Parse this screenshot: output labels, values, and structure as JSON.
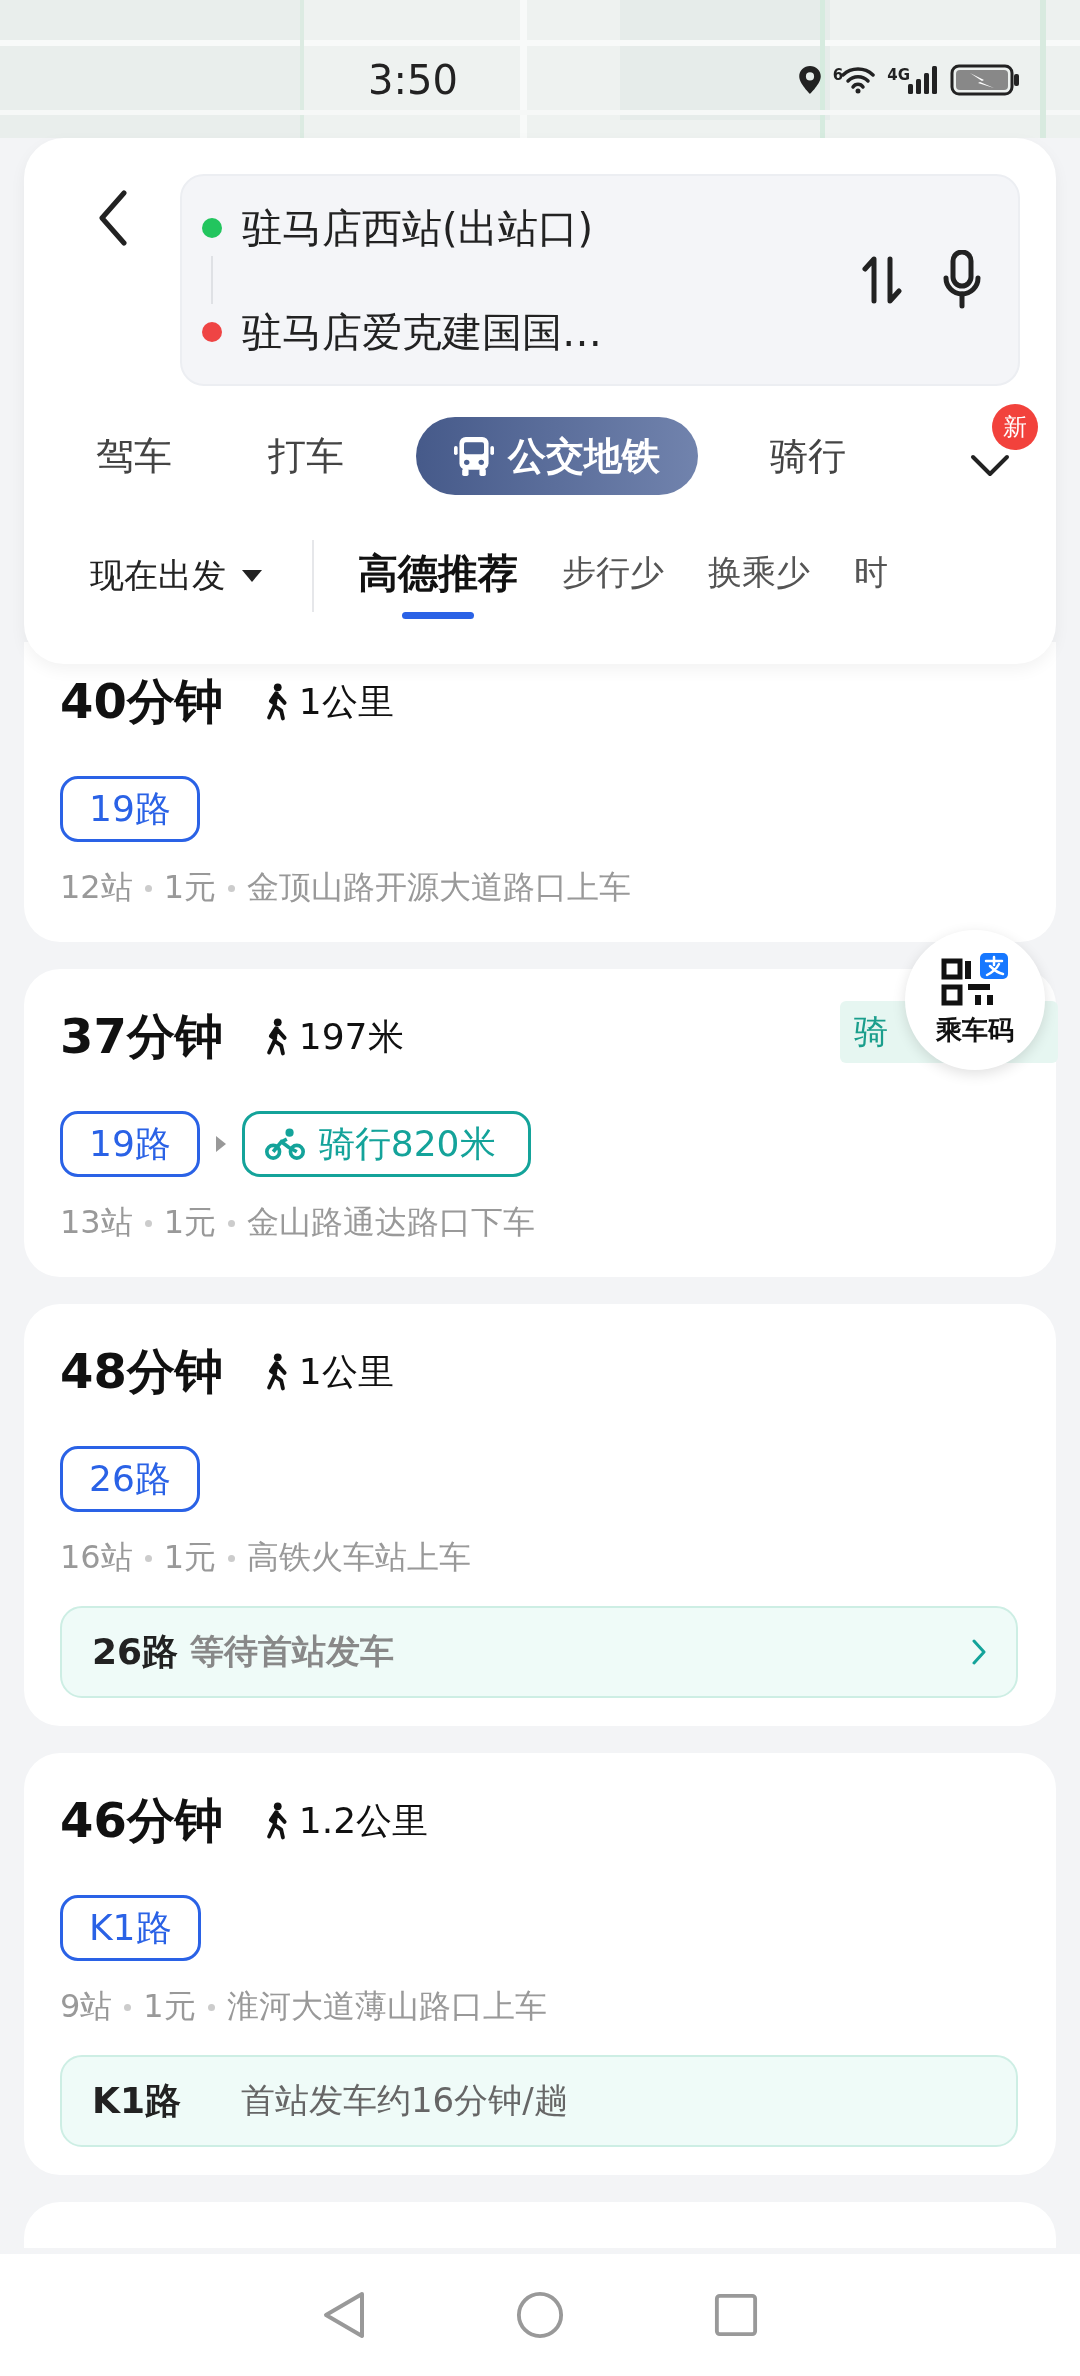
{
  "status_bar": {
    "time": "3:50",
    "wifi_label": "6",
    "cell_label": "4G"
  },
  "search": {
    "origin": {
      "text": "驻马店西站(出站口)",
      "color": "#22c55e"
    },
    "destination": {
      "text": "驻马店爱克建国国…",
      "color": "#ef4444"
    }
  },
  "mode_tabs": [
    {
      "label": "驾车",
      "selected": false
    },
    {
      "label": "打车",
      "selected": false
    },
    {
      "label": "公交地铁",
      "selected": true
    },
    {
      "label": "骑行",
      "selected": false
    }
  ],
  "more_badge": "新",
  "departure": "现在出发",
  "sort_tabs": [
    {
      "label": "高德推荐",
      "selected": true
    },
    {
      "label": "步行少",
      "selected": false
    },
    {
      "label": "换乘少",
      "selected": false
    },
    {
      "label": "时",
      "selected": false
    }
  ],
  "routes": [
    {
      "duration": "40分钟",
      "walk": "1公里",
      "segments": [
        {
          "kind": "bus",
          "label": "19路"
        }
      ],
      "stops": "12站",
      "fare": "1元",
      "station": "金顶山路开源大道路口上车"
    },
    {
      "duration": "37分钟",
      "walk": "197米",
      "side_tag": "骑",
      "segments": [
        {
          "kind": "bus",
          "label": "19路"
        },
        {
          "kind": "bike",
          "label": "骑行820米"
        }
      ],
      "stops": "13站",
      "fare": "1元",
      "station": "金山路通达路口下车"
    },
    {
      "duration": "48分钟",
      "walk": "1公里",
      "segments": [
        {
          "kind": "bus",
          "label": "26路"
        }
      ],
      "stops": "16站",
      "fare": "1元",
      "station": "高铁火车站上车",
      "notice": {
        "line": "26路",
        "text": "等待首站发车",
        "arrow": true
      }
    },
    {
      "duration": "46分钟",
      "walk": "1.2公里",
      "segments": [
        {
          "kind": "bus",
          "label": "K1路"
        }
      ],
      "stops": "9站",
      "fare": "1元",
      "station": "淮河大道薄山路口上车",
      "notice": {
        "line": "K1路",
        "text": "首站发车约16分钟/趟",
        "arrow": false
      }
    }
  ],
  "ride_code": {
    "label": "乘车码"
  }
}
